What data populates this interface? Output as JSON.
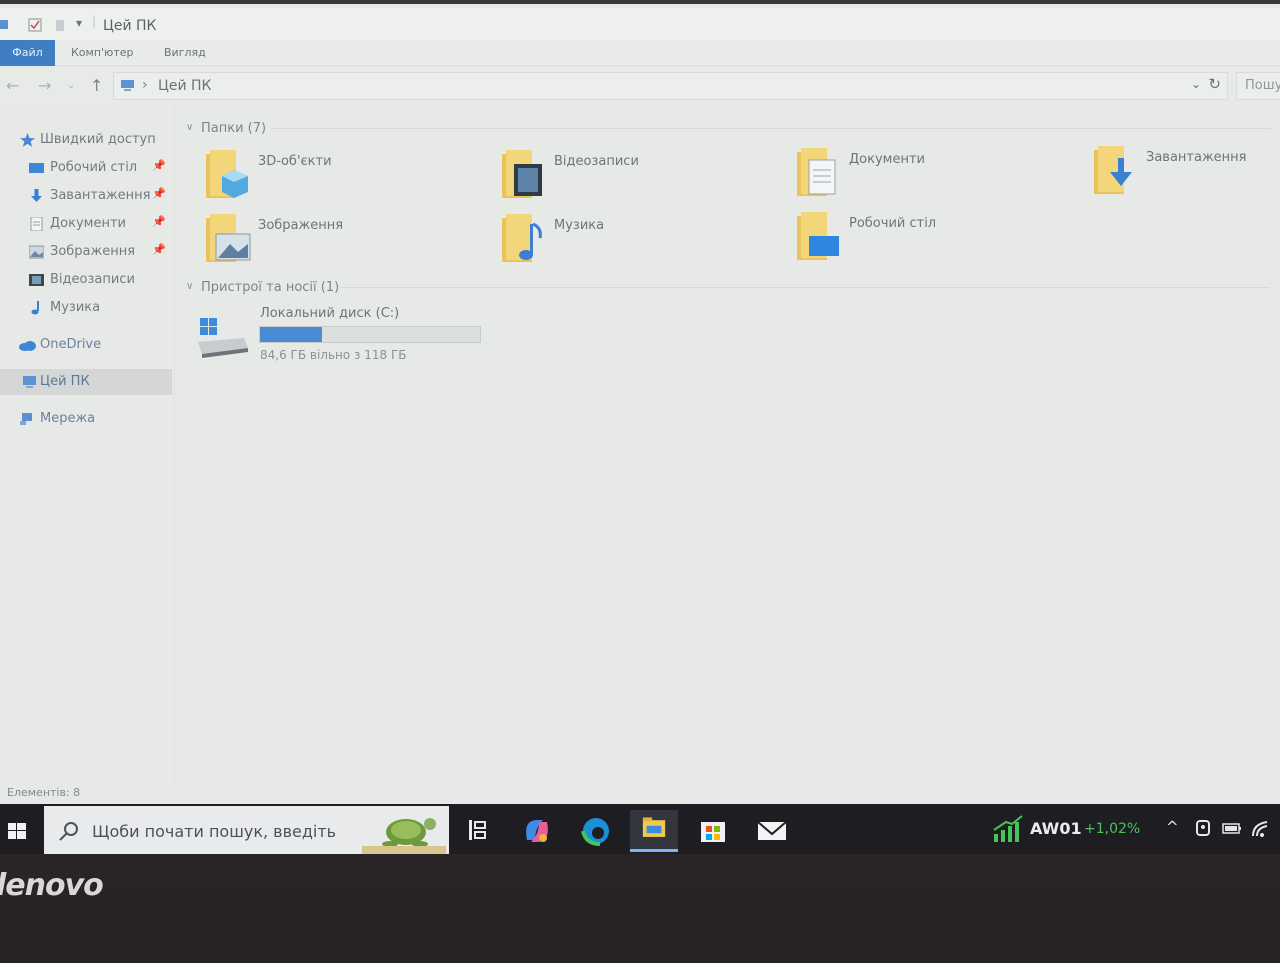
{
  "window": {
    "title": "Цей ПК",
    "tabs": [
      "Файл",
      "Комп'ютер",
      "Вигляд"
    ],
    "address": {
      "crumb": "Цей ПК",
      "search_placeholder": "Пошу"
    }
  },
  "sidebar": {
    "quick_access": "Швидкий доступ",
    "items": [
      {
        "label": "Робочий стіл",
        "pinned": true
      },
      {
        "label": "Завантаження",
        "pinned": true
      },
      {
        "label": "Документи",
        "pinned": true
      },
      {
        "label": "Зображення",
        "pinned": true
      },
      {
        "label": "Відеозаписи",
        "pinned": false
      },
      {
        "label": "Музика",
        "pinned": false
      }
    ],
    "onedrive": "OneDrive",
    "this_pc": "Цей ПК",
    "network": "Мережа"
  },
  "content": {
    "folders_group": "Папки (7)",
    "folders": [
      {
        "label": "3D-об'єкти",
        "icon": "3d-objects-folder-icon"
      },
      {
        "label": "Відеозаписи",
        "icon": "videos-folder-icon"
      },
      {
        "label": "Документи",
        "icon": "documents-folder-icon"
      },
      {
        "label": "Завантаження",
        "icon": "downloads-folder-icon"
      },
      {
        "label": "Зображення",
        "icon": "pictures-folder-icon"
      },
      {
        "label": "Музика",
        "icon": "music-folder-icon"
      },
      {
        "label": "Робочий стіл",
        "icon": "desktop-folder-icon"
      }
    ],
    "devices_group": "Пристрої та носії (1)",
    "drive": {
      "name": "Локальний диск (C:)",
      "free_text": "84,6 ГБ вільно з 118 ГБ",
      "used_fraction": 0.283
    }
  },
  "statusbar": {
    "items": "Елементів: 8"
  },
  "taskbar": {
    "search_placeholder": "Щоби почати пошук, введіть",
    "stock_ticker": "AW01",
    "stock_change": "+1,02%"
  },
  "brand": "lenovo",
  "colors": {
    "accent": "#3f7ec3",
    "drive_fill": "#4a8bd6",
    "stock_up": "#49c25a"
  }
}
